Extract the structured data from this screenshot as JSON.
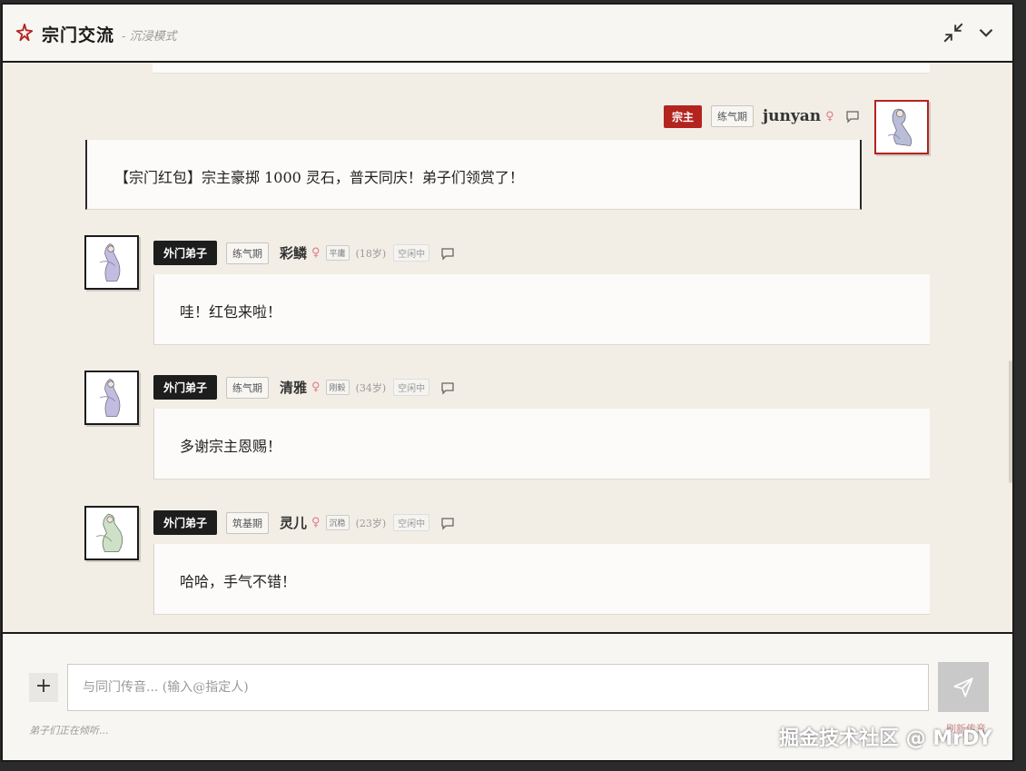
{
  "header": {
    "title": "宗门交流",
    "subtitle": "- 沉浸模式",
    "logo_icon": "sparkle-icon",
    "minimize_icon": "collapse-icon",
    "dropdown_icon": "chevron-down-icon"
  },
  "own_message": {
    "badge": "宗主",
    "realm": "练气期",
    "name": "junyan",
    "gender": "♀",
    "text": "【宗门红包】宗主豪掷 1000 灵石，普天同庆！弟子们领赏了！"
  },
  "messages": [
    {
      "badge": "外门弟子",
      "realm": "练气期",
      "name": "彩鳞",
      "gender": "♀",
      "trait": "平庸",
      "age": "(18岁)",
      "status": "空闲中",
      "text": "哇！红包来啦！"
    },
    {
      "badge": "外门弟子",
      "realm": "练气期",
      "name": "清雅",
      "gender": "♀",
      "trait": "刚毅",
      "age": "(34岁)",
      "status": "空闲中",
      "text": "多谢宗主恩赐！"
    },
    {
      "badge": "外门弟子",
      "realm": "筑基期",
      "name": "灵儿",
      "gender": "♀",
      "trait": "沉稳",
      "age": "(23岁)",
      "status": "空闲中",
      "text": "哈哈，手气不错！"
    }
  ],
  "footer": {
    "add_label": "+",
    "input_placeholder": "与同门传音... (输入@指定人)",
    "send_icon": "send-icon",
    "listening_text": "弟子们正在倾听...",
    "refresh_label": "刷新传音"
  },
  "watermark": "掘金技术社区 @ MrDY",
  "colors": {
    "accent": "#b3241f",
    "badge_dark": "#1d1d1d",
    "background": "#f2eee6"
  }
}
